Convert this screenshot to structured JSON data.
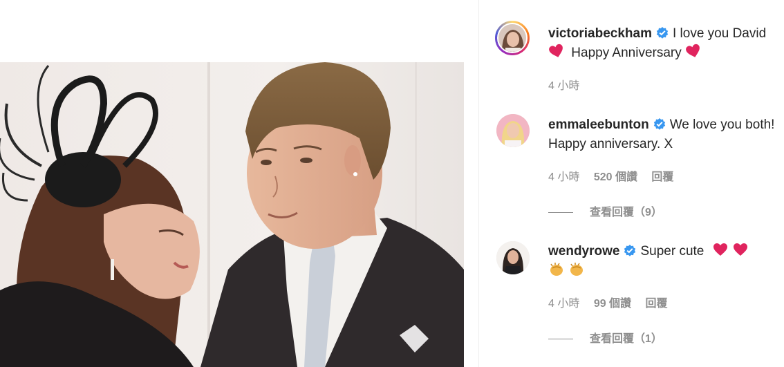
{
  "comments": [
    {
      "username": "victoriabeckham",
      "text_part1": "I love you David",
      "text_part2": "Happy Anniversary",
      "time": "4 小時"
    },
    {
      "username": "emmaleebunton",
      "text": "We love you both! Happy anniversary. X",
      "time": "4 小時",
      "likes": "520 個讚",
      "reply": "回覆",
      "view_replies": "查看回覆（9）"
    },
    {
      "username": "wendyrowe",
      "text": "Super cute",
      "time": "4 小時",
      "likes": "99 個讚",
      "reply": "回覆",
      "view_replies": "查看回覆（1）"
    }
  ],
  "colors": {
    "verified": "#3897f0",
    "heart": "#e0245e",
    "meta": "#8e8e8e",
    "text": "#262626"
  },
  "icons": [
    "verified-badge-icon",
    "red-heart-icon",
    "two-hearts-icon",
    "clapping-hands-icon"
  ]
}
